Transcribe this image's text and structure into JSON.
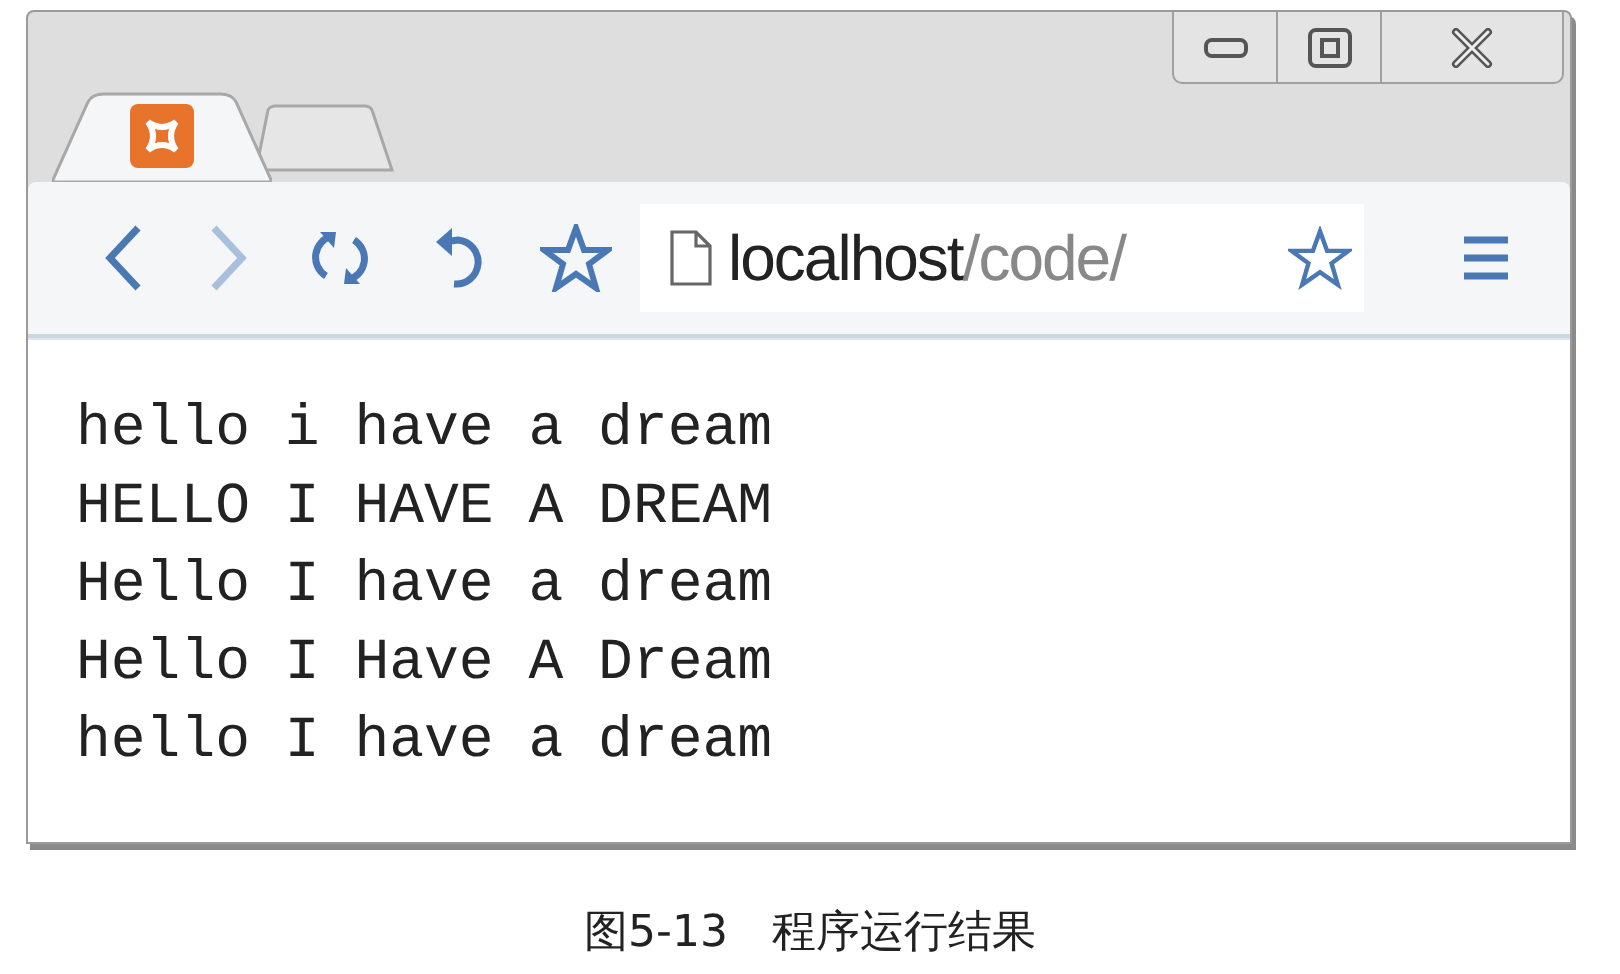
{
  "tabs": [
    {
      "selected": true
    },
    {
      "selected": false
    }
  ],
  "toolbar": {
    "back": {
      "disabled": false
    },
    "forward": {
      "disabled": true
    }
  },
  "address": {
    "host": "localhost",
    "path": "/code/"
  },
  "lines": [
    "hello i have a dream",
    "HELLO I HAVE A DREAM",
    "Hello I have a dream",
    "Hello I Have A Dream",
    "hello I have a dream"
  ],
  "caption": "图5-13　程序运行结果"
}
